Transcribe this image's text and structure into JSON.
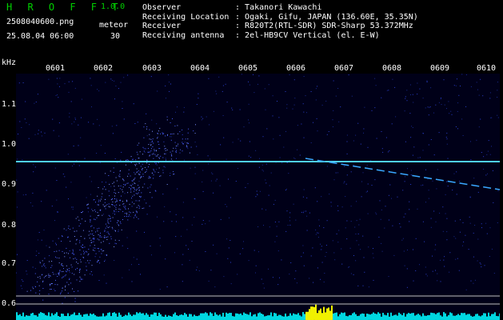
{
  "header": {
    "app_title": "H R O F F T",
    "version": "1.0.0",
    "file_name": "2508040600.png",
    "timestamp": "25.08.04 06:00",
    "meteor_label": "meteor",
    "meteor_count": "30",
    "info_rows": [
      {
        "label": "Observer",
        "value": "Takanori Kawachi"
      },
      {
        "label": "Receiving Location",
        "value": "Ogaki, Gifu, JAPAN (136.60E, 35.35N)"
      },
      {
        "label": "Receiver",
        "value": "R820T2(RTL-SDR) SDR-Sharp 53.372MHz"
      },
      {
        "label": "Receiving antenna",
        "value": "2el-HB9CV Vertical (el. E-W)"
      }
    ]
  },
  "spectrogram": {
    "y_unit": "kHz",
    "y_ticks": [
      "1.1",
      "1.0",
      "0.9",
      "0.8",
      "0.7",
      "0.6"
    ],
    "x_ticks": [
      "0601",
      "0602",
      "0603",
      "0604",
      "0605",
      "0606",
      "0607",
      "0608",
      "0609",
      "0610"
    ],
    "colors": {
      "background": "#000018",
      "trace": "#4fd0ff",
      "noise": "#2b3fd0",
      "bars": "#00d7e0",
      "spikes": "#f0f000"
    }
  }
}
